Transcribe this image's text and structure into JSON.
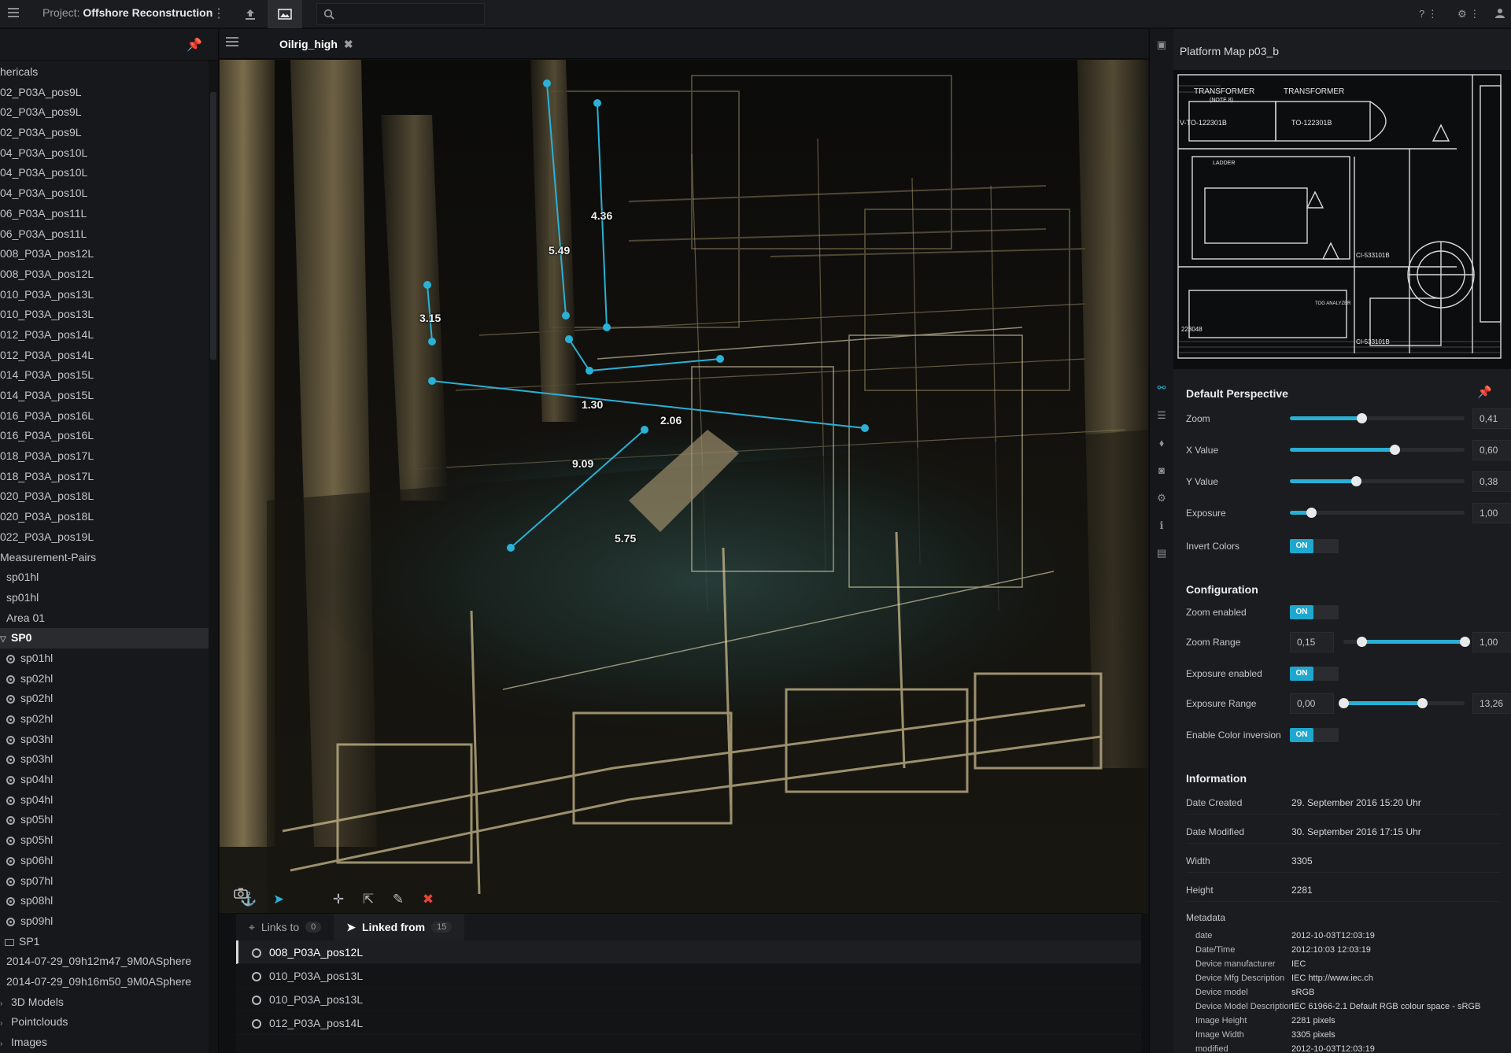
{
  "topbar": {
    "project_prefix": "Project:",
    "project_name": "Offshore Reconstruction"
  },
  "tree": {
    "items": [
      {
        "label": "hericals",
        "type": "plain"
      },
      {
        "label": "02_P03A_pos9L",
        "type": "plain"
      },
      {
        "label": "02_P03A_pos9L",
        "type": "plain"
      },
      {
        "label": "02_P03A_pos9L",
        "type": "plain"
      },
      {
        "label": "04_P03A_pos10L",
        "type": "plain"
      },
      {
        "label": "04_P03A_pos10L",
        "type": "plain"
      },
      {
        "label": "04_P03A_pos10L",
        "type": "plain"
      },
      {
        "label": "06_P03A_pos11L",
        "type": "plain"
      },
      {
        "label": "06_P03A_pos11L",
        "type": "plain"
      },
      {
        "label": "008_P03A_pos12L",
        "type": "plain"
      },
      {
        "label": "008_P03A_pos12L",
        "type": "plain"
      },
      {
        "label": "010_P03A_pos13L",
        "type": "plain"
      },
      {
        "label": "010_P03A_pos13L",
        "type": "plain"
      },
      {
        "label": "012_P03A_pos14L",
        "type": "plain"
      },
      {
        "label": "012_P03A_pos14L",
        "type": "plain"
      },
      {
        "label": "014_P03A_pos15L",
        "type": "plain"
      },
      {
        "label": "014_P03A_pos15L",
        "type": "plain"
      },
      {
        "label": "016_P03A_pos16L",
        "type": "plain"
      },
      {
        "label": "016_P03A_pos16L",
        "type": "plain"
      },
      {
        "label": "018_P03A_pos17L",
        "type": "plain"
      },
      {
        "label": "018_P03A_pos17L",
        "type": "plain"
      },
      {
        "label": "020_P03A_pos18L",
        "type": "plain"
      },
      {
        "label": "020_P03A_pos18L",
        "type": "plain"
      },
      {
        "label": "022_P03A_pos19L",
        "type": "plain"
      },
      {
        "label": "Measurement-Pairs",
        "type": "plain"
      },
      {
        "label": "sp01hl",
        "type": "indent"
      },
      {
        "label": "sp01hl",
        "type": "indent"
      },
      {
        "label": "Area 01",
        "type": "indent"
      },
      {
        "label": "SP0",
        "type": "folder-open"
      },
      {
        "label": "sp01hl",
        "type": "child"
      },
      {
        "label": "sp02hl",
        "type": "child"
      },
      {
        "label": "sp02hl",
        "type": "child"
      },
      {
        "label": "sp02hl",
        "type": "child"
      },
      {
        "label": "sp03hl",
        "type": "child"
      },
      {
        "label": "sp03hl",
        "type": "child"
      },
      {
        "label": "sp04hl",
        "type": "child"
      },
      {
        "label": "sp04hl",
        "type": "child"
      },
      {
        "label": "sp05hl",
        "type": "child"
      },
      {
        "label": "sp05hl",
        "type": "child"
      },
      {
        "label": "sp06hl",
        "type": "child"
      },
      {
        "label": "sp07hl",
        "type": "child"
      },
      {
        "label": "sp08hl",
        "type": "child"
      },
      {
        "label": "sp09hl",
        "type": "child"
      },
      {
        "label": "SP1",
        "type": "folder"
      },
      {
        "label": "2014-07-29_09h12m47_9M0ASphere",
        "type": "indent"
      },
      {
        "label": "2014-07-29_09h16m50_9M0ASphere",
        "type": "indent"
      },
      {
        "label": "3D Models",
        "type": "caret"
      },
      {
        "label": "Pointclouds",
        "type": "caret"
      },
      {
        "label": "Images",
        "type": "caret"
      }
    ]
  },
  "viewport": {
    "tab_label": "Oilrig_high",
    "measurements": [
      "4.36",
      "5.49",
      "3.15",
      "1.30",
      "2.06",
      "9.09",
      "5.75"
    ]
  },
  "links": {
    "tab_links_to": "Links to",
    "links_to_count": "0",
    "tab_linked_from": "Linked from",
    "linked_from_count": "15",
    "items": [
      "008_P03A_pos12L",
      "010_P03A_pos13L",
      "010_P03A_pos13L",
      "012_P03A_pos14L"
    ]
  },
  "right": {
    "panel_title": "Platform Map p03_b",
    "blueprint_labels": [
      "TRANSFORMER",
      "TRANSFORMER",
      "(NOTE 8)",
      "V-TO-122301B",
      "TO-122301B",
      "LADDER",
      "CI-533101B",
      "CI-533101B",
      "TOG ANALYZER",
      "223048"
    ],
    "perspective": {
      "title": "Default Perspective",
      "zoom_label": "Zoom",
      "zoom_value": "0,41",
      "zoom_level": 0.41,
      "x_label": "X Value",
      "x_value": "0,60",
      "x_level": 0.6,
      "y_label": "Y Value",
      "y_value": "0,38",
      "y_level": 0.38,
      "exposure_label": "Exposure",
      "exposure_value": "1,00",
      "exposure_level": 0.12,
      "invert_label": "Invert Colors",
      "invert_state": "ON"
    },
    "configuration": {
      "title": "Configuration",
      "zoom_enabled_label": "Zoom enabled",
      "zoom_enabled_state": "ON",
      "zoom_range_label": "Zoom Range",
      "zoom_range_min": "0,15",
      "zoom_range_max": "1,00",
      "zoom_range_low": 0.15,
      "zoom_range_high": 1.0,
      "exposure_enabled_label": "Exposure enabled",
      "exposure_enabled_state": "ON",
      "exposure_range_label": "Exposure Range",
      "exposure_range_min": "0,00",
      "exposure_range_max": "13,26",
      "exposure_range_low": 0.0,
      "exposure_range_high": 0.65,
      "color_inversion_label": "Enable Color inversion",
      "color_inversion_state": "ON"
    },
    "information": {
      "title": "Information",
      "rows": [
        {
          "k": "Date Created",
          "v": "29. September 2016 15:20 Uhr"
        },
        {
          "k": "Date Modified",
          "v": "30. September 2016 17:15 Uhr"
        },
        {
          "k": "Width",
          "v": "3305"
        },
        {
          "k": "Height",
          "v": "2281"
        }
      ],
      "metadata_title": "Metadata",
      "metadata": [
        {
          "k": "date",
          "v": "2012-10-03T12:03:19"
        },
        {
          "k": "Date/Time",
          "v": "2012:10:03 12:03:19"
        },
        {
          "k": "Device manufacturer",
          "v": "IEC"
        },
        {
          "k": "Device Mfg Description",
          "v": "IEC http://www.iec.ch"
        },
        {
          "k": "Device model",
          "v": "sRGB"
        },
        {
          "k": "Device Model Description",
          "v": "IEC 61966-2.1 Default RGB colour space - sRGB"
        },
        {
          "k": "Image Height",
          "v": "2281 pixels"
        },
        {
          "k": "Image Width",
          "v": "3305 pixels"
        },
        {
          "k": "modified",
          "v": "2012-10-03T12:03:19"
        }
      ]
    }
  },
  "colors": {
    "accent": "#29afd4",
    "warn": "#e0453b",
    "pin": "#d6a23a"
  }
}
